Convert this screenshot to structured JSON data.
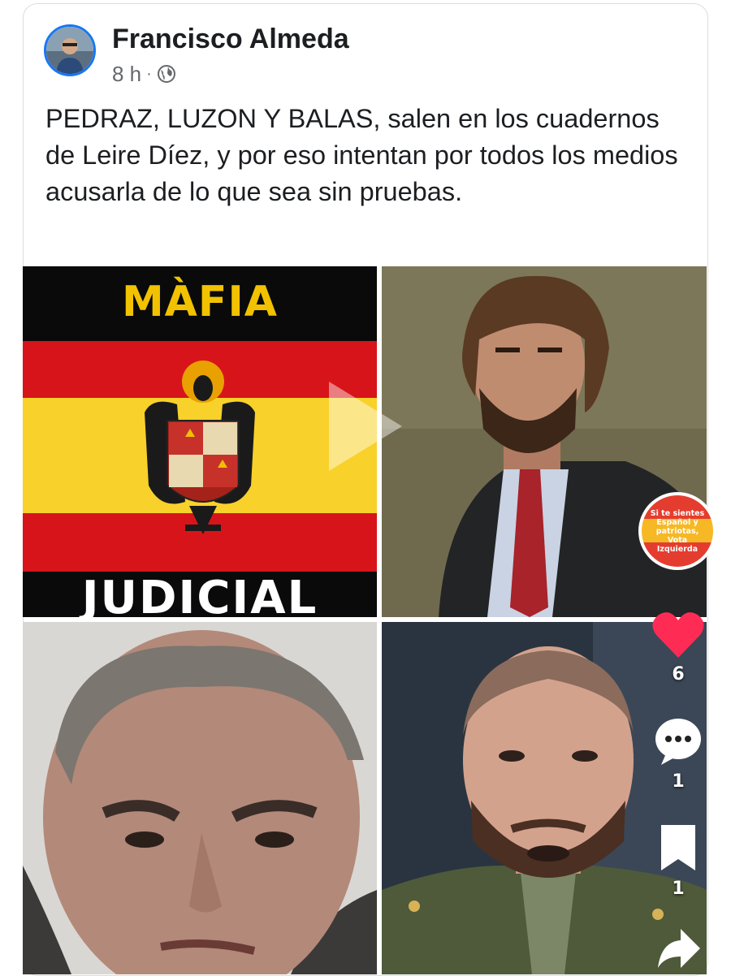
{
  "post": {
    "author": "Francisco Almeda",
    "time": "8 h",
    "separator": "·",
    "audience_icon": "globe-icon",
    "text": "PEDRAZ, LUZON Y BALAS, salen en los cuadernos de Leire Díez, y por eso intentan por todos los medios acusarla de lo que sea sin pruebas."
  },
  "images": {
    "tile1": {
      "top_text": "MÀFIA",
      "bottom_text": "JUDICIAL"
    },
    "sticker": {
      "text": "Si te sientes Español y patriotas, Vota Izquierda"
    }
  },
  "actions": {
    "likes": "6",
    "comments": "1",
    "saves": "1"
  },
  "colors": {
    "flag_red": "#d8141b",
    "flag_yellow": "#f8d12a",
    "like_red": "#fe2c55",
    "name_text": "#1c1e21",
    "meta_text": "#65676b",
    "avatar_ring": "#1877f2"
  }
}
